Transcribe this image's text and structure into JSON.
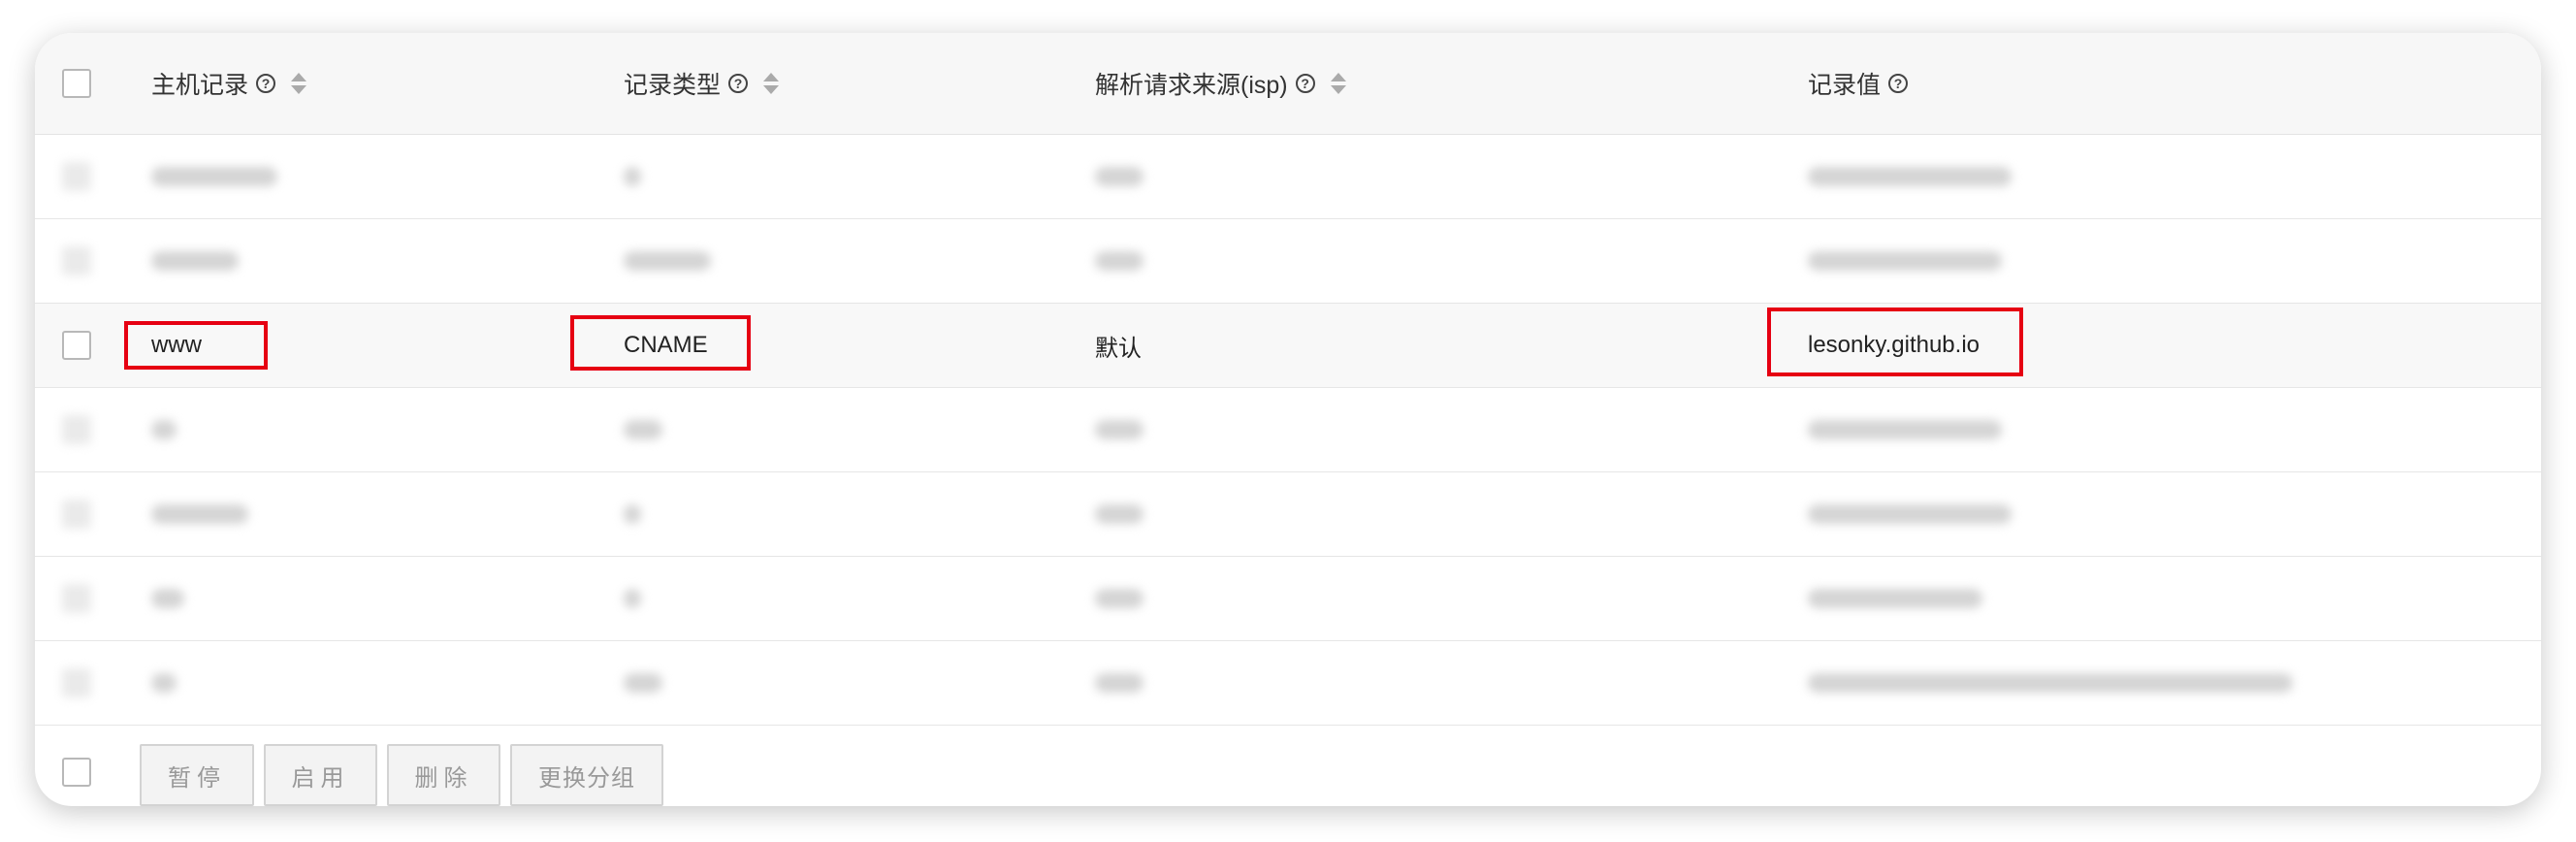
{
  "table": {
    "headers": {
      "host": "主机记录",
      "type": "记录类型",
      "isp": "解析请求来源(isp)",
      "value": "记录值"
    },
    "highlighted_row": {
      "host": "www",
      "type": "CNAME",
      "isp": "默认",
      "value": "lesonky.github.io"
    }
  },
  "footer": {
    "pause_label": "暂停",
    "enable_label": "启用",
    "delete_label": "删除",
    "change_group_label": "更换分组"
  },
  "icons": {
    "help": "question-circle-icon",
    "sort": "sort-caret-icon"
  },
  "colors": {
    "highlight_box": "#e60012"
  }
}
